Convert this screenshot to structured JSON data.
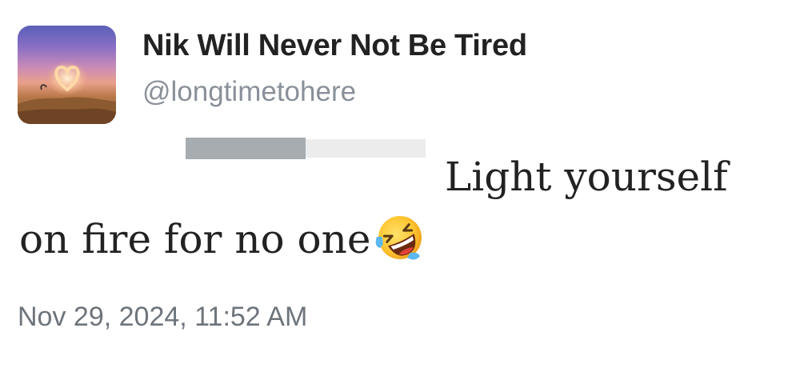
{
  "tweet": {
    "display_name": "Nik Will Never Not Be Tired",
    "handle": "@longtimetohere",
    "text_line_1": "Light yourself",
    "text_line_2": "on fire for no one",
    "emoji": "rolling-on-the-floor-laughing-emoji",
    "timestamp": "Nov 29, 2024, 11:52 AM"
  }
}
